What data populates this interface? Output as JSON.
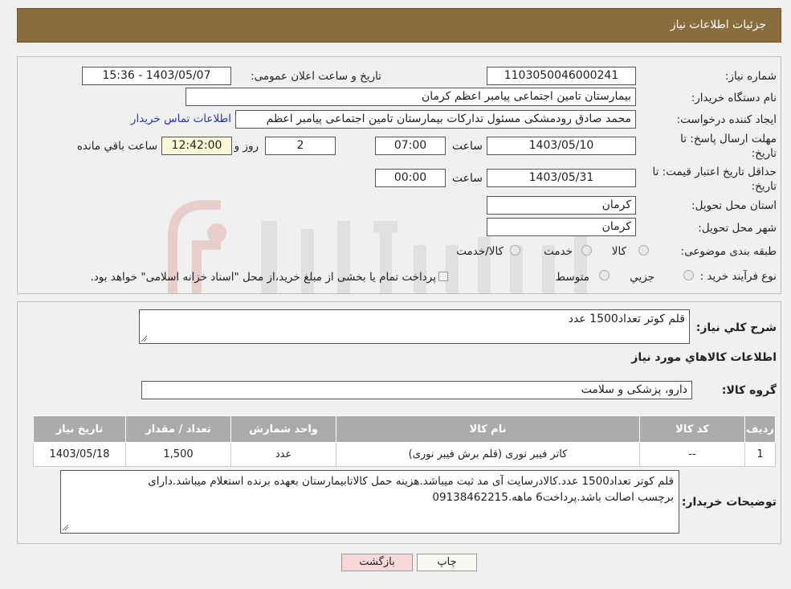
{
  "header": {
    "title": "جزئیات اطلاعات نیاز"
  },
  "form": {
    "need_number_label": "شماره نیاز:",
    "need_number": "1103050046000241",
    "announce_label": "تاریخ و ساعت اعلان عمومی:",
    "announce_value": "1403/05/07 - 15:36",
    "buyer_org_label": "نام دستگاه خریدار:",
    "buyer_org": "بیمارستان تامین اجتماعی پیامبر اعظم کرمان",
    "creator_label": "ایجاد کننده درخواست:",
    "creator": "محمد صادق  رودمشکی مسئول تدارکات بیمارستان تامین اجتماعی پیامبر اعظم",
    "contact_link": "اطلاعات تماس خریدار",
    "deadline_label_1": "مهلت ارسال پاسخ: تا",
    "deadline_label_2": "تاریخ:",
    "deadline_date": "1403/05/10",
    "time_label": "ساعت",
    "deadline_time": "07:00",
    "days_value": "2",
    "days_label": "روز و",
    "remaining_time": "12:42:00",
    "remaining_label": "ساعت باقي مانده",
    "validity_label_1": "حداقل تاریخ اعتبار قیمت: تا",
    "validity_label_2": "تاریخ:",
    "validity_date": "1403/05/31",
    "validity_time": "00:00",
    "province_label": "استان محل تحویل:",
    "province": "کرمان",
    "city_label": "شهر محل تحویل:",
    "city": "کرمان",
    "category_label": "طبقه بندی موضوعی:",
    "category_options": [
      "کالا",
      "خدمت",
      "کالا/خدمت"
    ],
    "process_label": "نوع فرآیند خرید :",
    "process_options": [
      "جزیي",
      "متوسط"
    ],
    "process_note": "پرداخت تمام یا بخشی از مبلغ خرید،از محل \"اسناد خزانه اسلامی\" خواهد بود."
  },
  "summary": {
    "general_label": "شرح کلي نياز:",
    "general_value": "قلم کوتر تعداد1500 عدد",
    "items_title": "اطلاعات کالاهاي مورد نياز",
    "group_label": "گروه کالا:",
    "group_value": "دارو، پزشکی و سلامت"
  },
  "table": {
    "headers": [
      "ردیف",
      "کد کالا",
      "نام کالا",
      "واحد شمارش",
      "تعداد / مقدار",
      "تاریخ نیاز"
    ],
    "rows": [
      [
        "1",
        "--",
        "کاتر فیبر نوری (قلم برش فیبر نوری)",
        "عدد",
        "1,500",
        "1403/05/18"
      ]
    ]
  },
  "buyer_notes": {
    "label": "توضیحات خریدار:",
    "line1": "قلم کوتر تعداد1500 عدد.کالادرسایت آی مد ثبت میباشد.هزینه حمل کالاتابیمارستان بعهده برنده استعلام میباشد.دارای",
    "line2": "برچسب اصالت باشد.پرداخت6 ماهه.09138462215"
  },
  "buttons": {
    "print": "چاپ",
    "back": "بازگشت"
  },
  "colors": {
    "header_bg": "#8a6d3d",
    "back_button_bg": "#f7d9d9",
    "table_header_bg": "#ababab"
  }
}
